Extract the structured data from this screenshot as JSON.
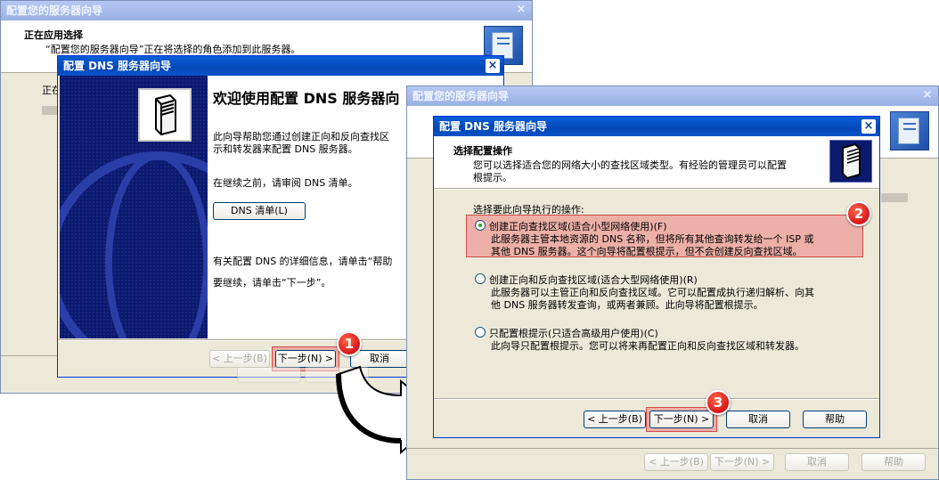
{
  "bg_window": {
    "title": "配置您的服务器向导",
    "section_title": "正在应用选择",
    "section_desc": "“配置您的服务器向导”正在将选择的角色添加到此服务器。",
    "status_text": "正在"
  },
  "dns_welcome": {
    "title": "配置 DNS 服务器向导",
    "heading": "欢迎使用配置 DNS 服务器向",
    "desc_line1": "此向导帮助您通过创建正向和反向查找区",
    "desc_line2": "示和转发器来配置 DNS 服务器。",
    "review_text": "在继续之前，请审阅 DNS 清单。",
    "checklist_button": "DNS 清单(L)",
    "more_info": "有关配置 DNS 的详细信息，请单击“帮助",
    "continue_text": "要继续，请单击“下一步”。",
    "back_button": "< 上一步(B)",
    "next_button": "下一步(N) >",
    "cancel_button": "取消"
  },
  "fg_window": {
    "title": "配置您的服务器向导",
    "back_button": "< 上一步(B)",
    "next_button": "下一步(N) >",
    "cancel_button": "取消",
    "help_button": "帮助"
  },
  "dns_config": {
    "title": "配置 DNS 服务器向导",
    "section_title": "选择配置操作",
    "section_desc_line1": "您可以选择适合您的网络大小的查找区域类型。有经验的管理员可以配置",
    "section_desc_line2": "根提示。",
    "prompt": "选择要此向导执行的操作:",
    "options": [
      {
        "label": "创建正向查找区域(适合小型网络使用)(F)",
        "desc_line1": "此服务器主管本地资源的 DNS 名称，但将所有其他查询转发给一个 ISP 或",
        "desc_line2": "其他 DNS 服务器。这个向导将配置根提示，但不会创建反向查找区域。",
        "selected": true
      },
      {
        "label": "创建正向和反向查找区域(适合大型网络使用)(R)",
        "desc_line1": "此服务器可以主管正向和反向查找区域。它可以配置成执行递归解析、向其",
        "desc_line2": "他 DNS 服务器转发查询，或两者兼顾。此向导将配置根提示。",
        "selected": false
      },
      {
        "label": "只配置根提示(只适合高级用户使用)(C)",
        "desc_line1": "此向导只配置根提示。您可以将来再配置正向和反向查找区域和转发器。",
        "desc_line2": "",
        "selected": false
      }
    ],
    "back_button": "< 上一步(B)",
    "next_button": "下一步(N) >",
    "cancel_button": "取消",
    "help_button": "帮助"
  },
  "annotations": {
    "badge1": "1",
    "badge2": "2",
    "badge3": "3"
  },
  "colors": {
    "title_active": "#0a52c8",
    "title_inactive": "#a6bbec",
    "highlight": "#e87a7a",
    "badge": "#d8141a"
  }
}
